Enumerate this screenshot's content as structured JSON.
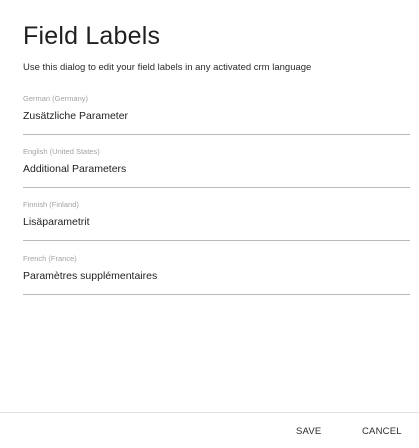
{
  "dialog": {
    "title": "Field Labels",
    "subtitle": "Use this dialog to edit your field labels in any activated crm language"
  },
  "fields": [
    {
      "label": "German (Germany)",
      "value": "Zusätzliche Parameter"
    },
    {
      "label": "English (United States)",
      "value": "Additional Parameters"
    },
    {
      "label": "Finnish (Finland)",
      "value": "Lisäparametrit"
    },
    {
      "label": "French (France)",
      "value": "Paramètres supplémentaires"
    }
  ],
  "footer": {
    "save_label": "SAVE",
    "cancel_label": "CANCEL"
  }
}
